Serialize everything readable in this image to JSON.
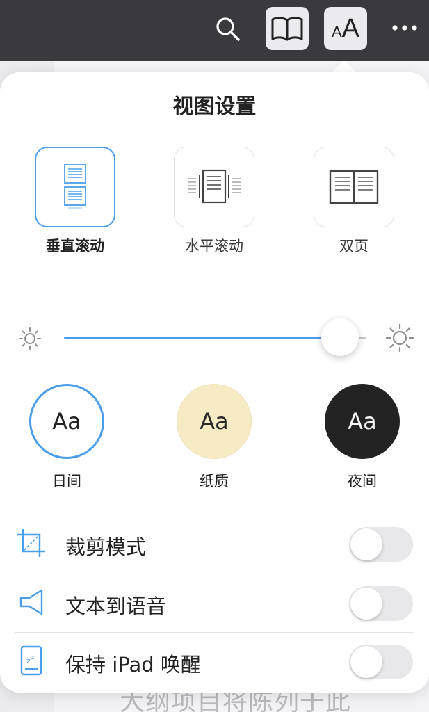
{
  "colors": {
    "accent": "#4a9de8",
    "toolbar": "#3a3a3e",
    "paper": "#f7ebc5",
    "night": "#232323"
  },
  "toolbar": {
    "icons": [
      "search-icon",
      "book-icon",
      "font-size-icon",
      "more-icon"
    ],
    "font_icon_small": "A",
    "font_icon_large": "A",
    "more_label": "•••"
  },
  "background": {
    "text": "大纲项目将陈列于此"
  },
  "popover": {
    "title": "视图设置",
    "layouts": [
      {
        "label": "垂直滚动",
        "icon": "vertical-scroll-icon",
        "selected": true
      },
      {
        "label": "水平滚动",
        "icon": "horizontal-scroll-icon",
        "selected": false
      },
      {
        "label": "双页",
        "icon": "two-page-icon",
        "selected": false
      }
    ],
    "brightness": {
      "value": 0.92,
      "min_icon": "sun-small-icon",
      "max_icon": "sun-large-icon"
    },
    "themes": [
      {
        "sample": "Aa",
        "label": "日间",
        "selected": true
      },
      {
        "sample": "Aa",
        "label": "纸质",
        "selected": false
      },
      {
        "sample": "Aa",
        "label": "夜间",
        "selected": false
      }
    ],
    "settings": [
      {
        "label": "裁剪模式",
        "icon": "crop-icon",
        "enabled": false
      },
      {
        "label": "文本到语音",
        "icon": "speaker-icon",
        "enabled": false
      },
      {
        "label": "保持 iPad 唤醒",
        "icon": "sleep-icon",
        "enabled": false
      }
    ]
  }
}
